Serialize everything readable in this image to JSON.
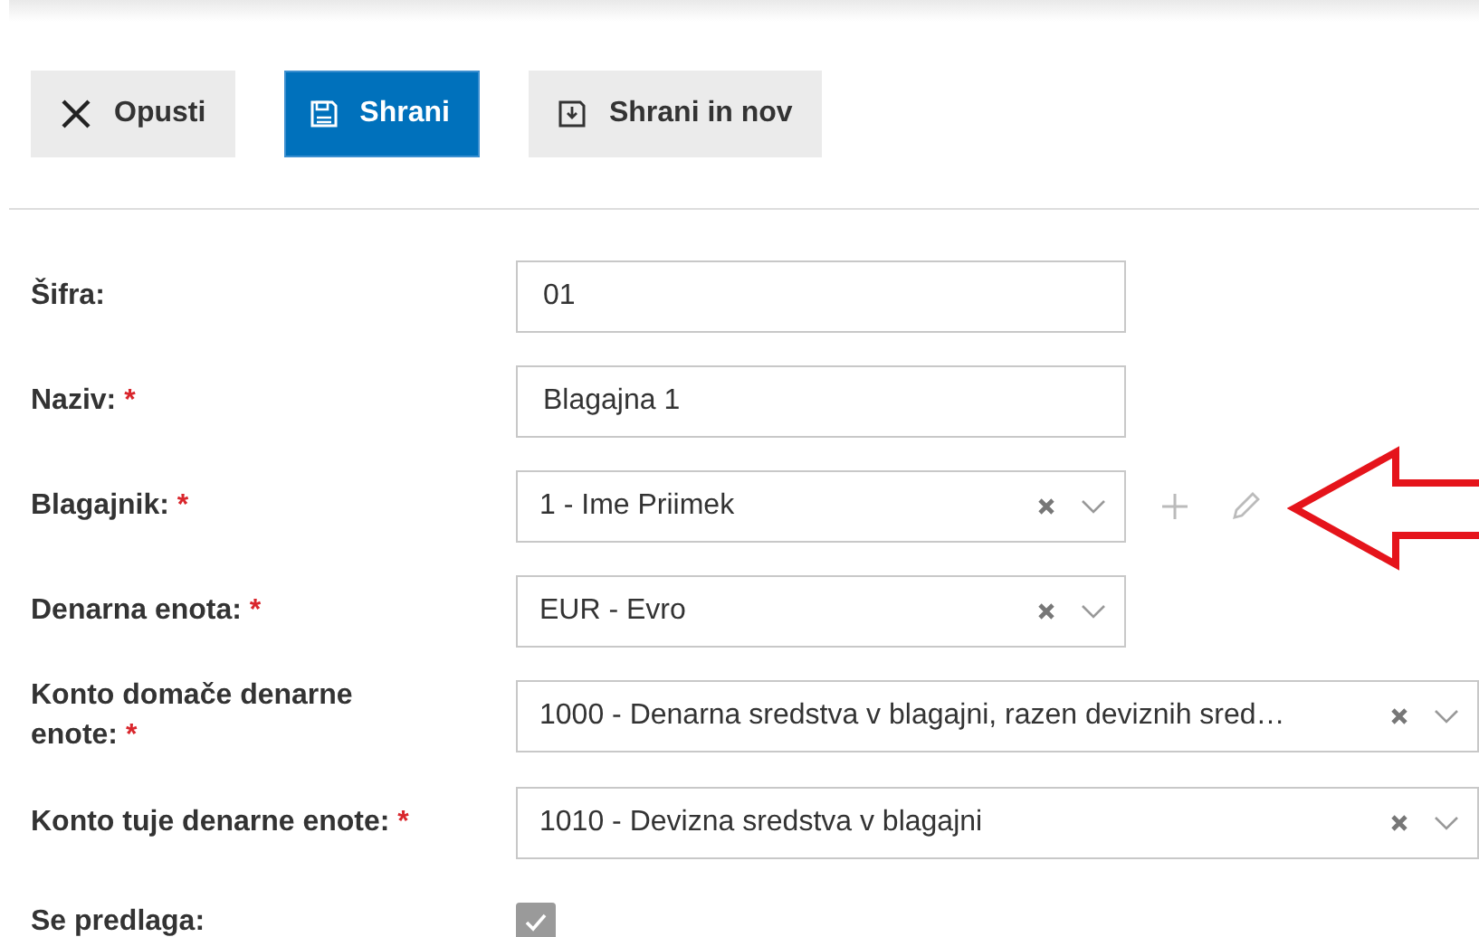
{
  "toolbar": {
    "buttons": [
      {
        "label": "Opusti",
        "kind": "cancel"
      },
      {
        "label": "Shrani",
        "kind": "primary"
      },
      {
        "label": "Shrani in nov",
        "kind": "save-new"
      }
    ]
  },
  "form": {
    "rows": [
      {
        "label": "Šifra:",
        "kind": "text",
        "value": "01"
      },
      {
        "label": "Naziv:",
        "required_mark": "*",
        "kind": "text",
        "value": "Blagajna 1"
      },
      {
        "label": "Blagajnik:",
        "required_mark": "*",
        "kind": "select",
        "value": "1 - Ime Priimek",
        "wide": false,
        "actions": true
      },
      {
        "label": "Denarna enota:",
        "required_mark": "*",
        "kind": "select",
        "value": "EUR - Evro",
        "wide": false,
        "actions": false
      },
      {
        "label": "Konto domače denarne enote:",
        "required_mark": "*",
        "kind": "select",
        "value": "1000 - Denarna sredstva v blagajni, razen deviznih sred…",
        "wide": true,
        "actions": false
      },
      {
        "label": "Konto tuje denarne enote:",
        "required_mark": "*",
        "kind": "select",
        "value": "1010 - Devizna sredstva v blagajni",
        "wide": true,
        "actions": false
      },
      {
        "label": "Se predlaga:",
        "kind": "checkbox",
        "checked": true
      }
    ]
  },
  "annotation": {
    "kind": "arrow"
  }
}
